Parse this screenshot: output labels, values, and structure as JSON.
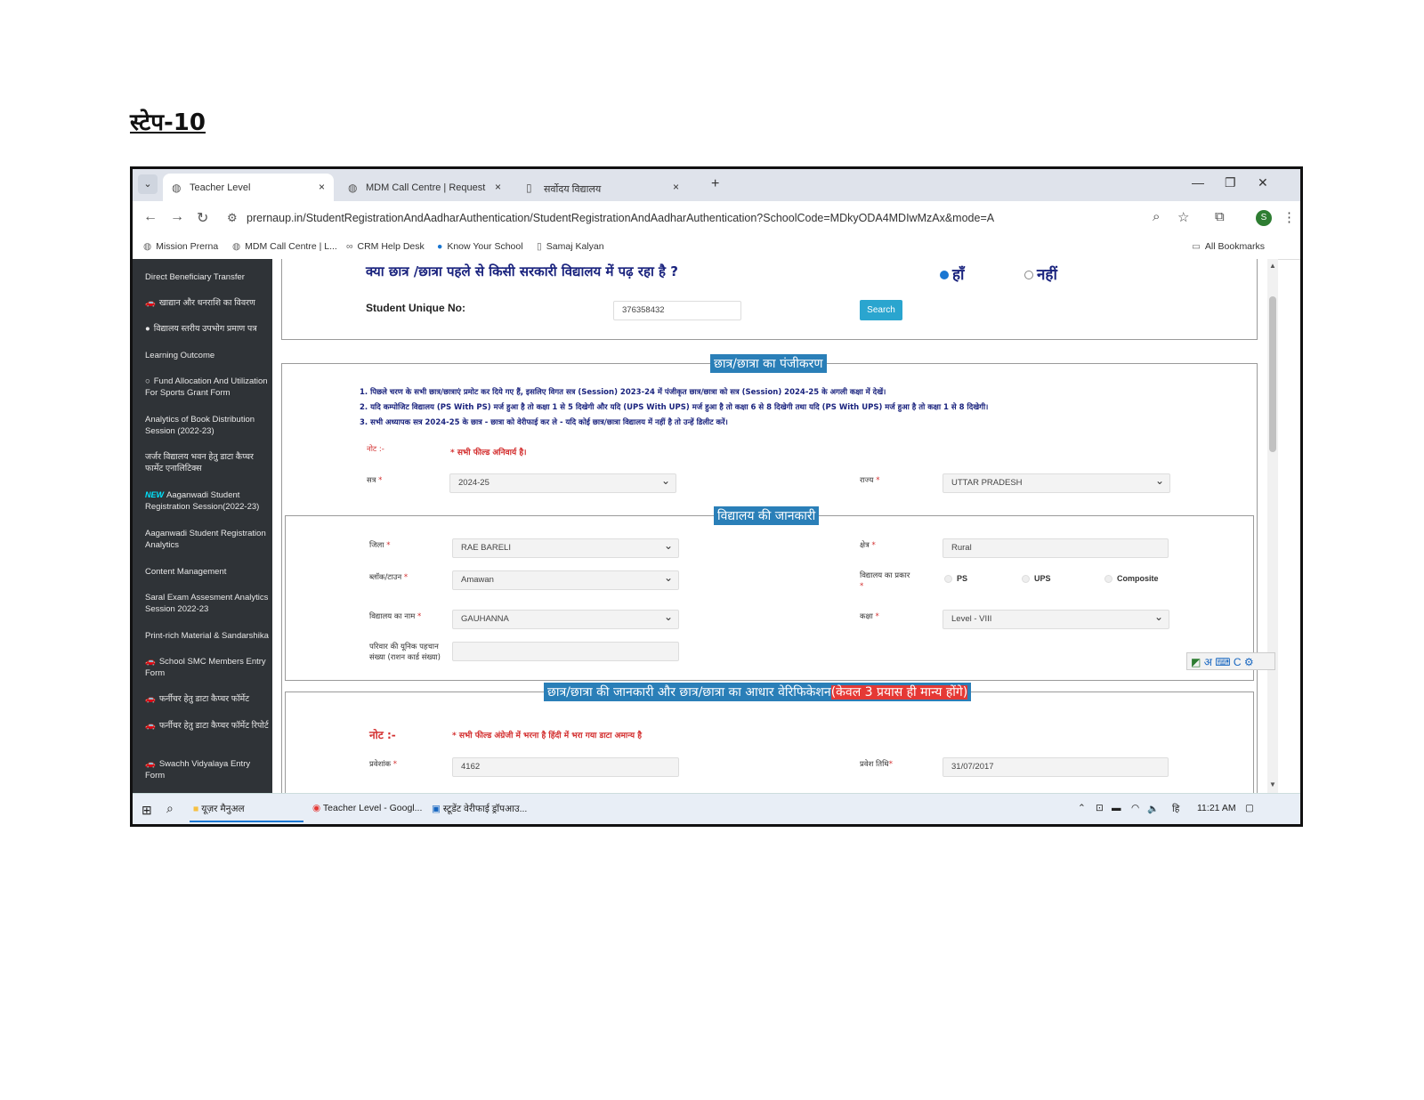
{
  "document": {
    "heading": "स्टेप-10"
  },
  "browser": {
    "tabs": [
      {
        "title": "Teacher Level",
        "icon": "globe-icon"
      },
      {
        "title": "MDM Call Centre | Request",
        "icon": "globe-icon"
      },
      {
        "title": "सर्वोदय विद्यालय",
        "icon": "page-icon"
      }
    ],
    "tab_close": "×",
    "new_tab": "+",
    "window_controls": {
      "minimize": "—",
      "restore": "❐",
      "close": "✕"
    },
    "url": "prernaup.in/StudentRegistrationAndAadharAuthentication/StudentRegistrationAndAadharAuthentication?SchoolCode=MDkyODA4MDIwMzAx&mode=A",
    "profile_initial": "S",
    "bookmarks": [
      "Mission Prerna",
      "MDM Call Centre | L...",
      "CRM Help Desk",
      "Know Your School",
      "Samaj Kalyan"
    ],
    "all_bookmarks": "All Bookmarks"
  },
  "sidebar": {
    "items": [
      {
        "label": "Direct Beneficiary Transfer",
        "icon": ""
      },
      {
        "label": "खाद्यान और धनराशि का विवरण",
        "icon": "🚗"
      },
      {
        "label": "विद्यालय स्तरीय उपभोग प्रमाण पत्र",
        "icon": "●"
      },
      {
        "label": "Learning Outcome",
        "icon": ""
      },
      {
        "label": "Fund Allocation And Utilization For Sports Grant Form",
        "icon": "○"
      },
      {
        "label": "Analytics of Book Distribution Session (2022-23)",
        "icon": ""
      },
      {
        "label": "जर्जर विद्यालय भवन हेतु डाटा कैप्चर फार्मेट एनालिटिक्स",
        "icon": ""
      },
      {
        "label": "Aaganwadi Student Registration Session(2022-23)",
        "icon": "",
        "badge": "NEW"
      },
      {
        "label": "Aaganwadi Student Registration Analytics",
        "icon": ""
      },
      {
        "label": "Content Management",
        "icon": ""
      },
      {
        "label": "Saral Exam Assesment Analytics Session 2022-23",
        "icon": ""
      },
      {
        "label": "Print-rich Material & Sandarshika",
        "icon": ""
      },
      {
        "label": "School SMC Members Entry Form",
        "icon": "🚗"
      },
      {
        "label": "फर्नीचर हेतु डाटा कैप्चर फॉर्मेट",
        "icon": "🚗"
      },
      {
        "label": "फर्नीचर हेतु डाटा कैप्चर फॉर्मेट रिपोर्ट",
        "icon": "🚗"
      },
      {
        "label": "Swachh Vidyalaya Entry Form",
        "icon": "🚗"
      }
    ]
  },
  "form": {
    "question": "क्या छात्र /छात्रा पहले से किसी सरकारी विद्यालय में पढ़ रहा है ?",
    "yes_label": "हाँ",
    "no_label": "नहीं",
    "yes_selected": true,
    "unique_no_label": "Student Unique No:",
    "unique_no_value": "376358432",
    "search_button": "Search",
    "registration_legend": "छात्र/छात्रा का पंजीकरण",
    "notes": [
      "1. पिछले चरण के सभी छात्र/छात्राएं प्रमोट कर दिये गए हैं, इसलिए विगत सत्र (Session) 2023-24 में पंजीकृत छात्र/छात्रा को सत्र (Session) 2024-25 के अगली कक्षा में देखें।",
      "2. यदि कम्पोजिट विद्यालय (PS With PS) मर्ज हुआ है तो कक्षा 1 से 5 दिखेगी और यदि (UPS With UPS) मर्ज हुआ है तो कक्षा 6 से 8 दिखेगी तथा यदि (PS With UPS) मर्ज हुआ है तो कक्षा 1 से 8 दिखेगी।",
      "3. सभी अध्यापक सत्र 2024-25 के छात्र - छात्रा को वेरीफाई कर ले - यदि कोई छात्र/छात्रा विद्यालय में नहीं है तो उन्हें डिलीट करें।"
    ],
    "note_label": "नोट :-",
    "required_note": "*  सभी फील्ड अनिवार्य है।",
    "session_label": "सत्र",
    "session_value": "2024-25",
    "state_label": "राज्य",
    "state_value": "UTTAR PRADESH",
    "school_legend": "विद्यालय की जानकारी",
    "district_label": "जिला",
    "district_value": "RAE BARELI",
    "area_label": "क्षेत्र",
    "area_value": "Rural",
    "block_label": "ब्लॉक/टाउन",
    "block_value": "Amawan",
    "school_type_label": "विद्यालय का प्रकार",
    "school_types": [
      "PS",
      "UPS",
      "Composite"
    ],
    "school_name_label": "विद्यालय का नाम",
    "school_name_value": "GAUHANNA",
    "class_label": "कक्षा",
    "class_value": "Level - VIII",
    "family_id_label": "परिवार की यूनिक पहचान संख्या (राशन कार्ड संख्या)",
    "student_legend": "छात्र/छात्रा की जानकारी  और छात्र/छात्रा का आधार वेरिफिकेशन",
    "student_legend_red": "(केवल 3 प्रयास ही मान्य होंगे)",
    "note2_label": "नोट :-",
    "english_note": "*  सभी फील्ड अंग्रेजी में भरना है हिंदी में भरा गया डाटा अमान्य है",
    "admission_no_label": "प्रवेशांक",
    "admission_no_value": "4162",
    "admission_date_label": "प्रवेश तिथि",
    "admission_date_value": "31/07/2017"
  },
  "ime_toolbar": "अ ⌨ C ⚙",
  "taskbar": {
    "items": [
      "यूज़र मैनुअल",
      "Teacher Level - Googl...",
      "स्टूडेंट वेरीफाई ड्रॉपआउ..."
    ],
    "lang": "हि",
    "time": "11:21 AM"
  },
  "colors": {
    "legend_bg": "#2a7fb8",
    "sidebar_bg": "#2f3337",
    "search_btn": "#2aa5cf",
    "title_blue": "#1a237e",
    "required_red": "#d32f2f"
  }
}
